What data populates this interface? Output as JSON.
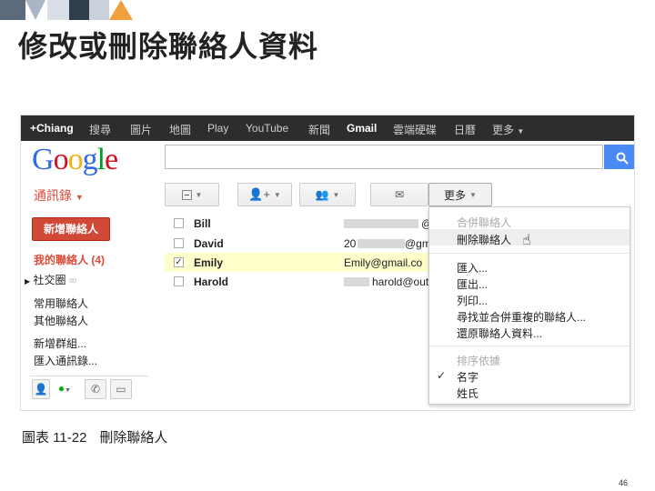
{
  "slide": {
    "title": "修改或刪除聯絡人資料",
    "caption_label": "圖表 11-22",
    "caption_text": "刪除聯絡人",
    "page_number": "46"
  },
  "topbar": {
    "user": "+Chiang",
    "items": [
      "搜尋",
      "圖片",
      "地圖",
      "Play",
      "YouTube",
      "新聞",
      "Gmail",
      "雲端硬碟",
      "日曆"
    ],
    "more": "更多"
  },
  "logo": "Google",
  "search": {
    "button_icon": "search-icon"
  },
  "contacts_label": "通訊錄",
  "toolbar": {
    "more_label": "更多"
  },
  "sidebar": {
    "new_contact": "新增聯絡人",
    "my_contacts": "我的聯絡人 (4)",
    "items": [
      "社交圈",
      "常用聯絡人",
      "其他聯絡人",
      "新增群組...",
      "匯入通訊錄..."
    ]
  },
  "contacts": [
    {
      "name": "Bill",
      "email": "@",
      "selected": false
    },
    {
      "name": "David",
      "email_prefix": "20",
      "email": "@gm",
      "selected": false
    },
    {
      "name": "Emily",
      "email": "Emily@gmail.co",
      "selected": true
    },
    {
      "name": "Harold",
      "email": "harold@out",
      "selected": false
    }
  ],
  "menu": {
    "merge": "合併聯絡人",
    "delete": "刪除聯絡人",
    "import": "匯入...",
    "export": "匯出...",
    "print": "列印...",
    "find_dupes": "尋找並合併重複的聯絡人...",
    "restore": "還原聯絡人資料...",
    "sort_header": "排序依據",
    "sort_first": "名字",
    "sort_last": "姓氏"
  },
  "colors": {
    "accent_red": "#dd4b39",
    "topbar_bg": "#2d2d2d",
    "search_blue": "#4a8af4",
    "highlight_row": "#ffffcc"
  }
}
